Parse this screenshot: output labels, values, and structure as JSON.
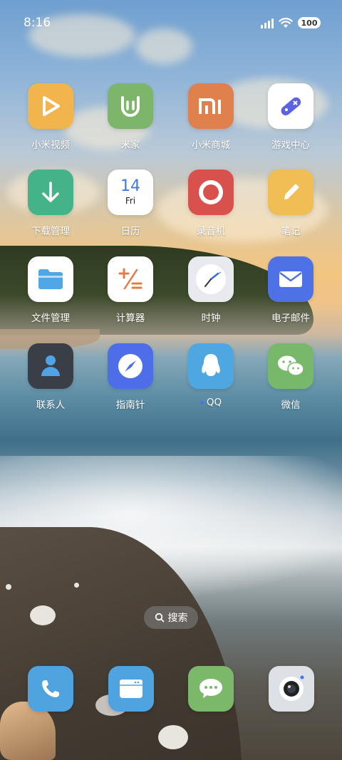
{
  "status_bar": {
    "time": "8:16",
    "battery": "100",
    "signal_icon": "cellular-signal-icon",
    "wifi_icon": "wifi-icon"
  },
  "apps": [
    {
      "label": "小米视频",
      "icon": "play-icon",
      "color": "#F2B54E"
    },
    {
      "label": "米家",
      "icon": "mijia-icon",
      "color": "#7DB56B"
    },
    {
      "label": "小米商城",
      "icon": "mi-logo-icon",
      "color": "#E0804C"
    },
    {
      "label": "游戏中心",
      "icon": "gamepad-icon",
      "color": "#FFFFFF"
    },
    {
      "label": "下载管理",
      "icon": "download-arrow-icon",
      "color": "#45B38A"
    },
    {
      "label": "日历",
      "icon": "calendar-icon",
      "color": "#FFFFFF",
      "day": "14",
      "weekday": "Fri"
    },
    {
      "label": "录音机",
      "icon": "record-icon",
      "color": "#D9514C"
    },
    {
      "label": "笔记",
      "icon": "pencil-icon",
      "color": "#F0BE55"
    },
    {
      "label": "文件管理",
      "icon": "folder-icon",
      "color": "#FFFFFF"
    },
    {
      "label": "计算器",
      "icon": "calculator-icon",
      "color": "#FFFFFF"
    },
    {
      "label": "时钟",
      "icon": "clock-icon",
      "color": "#E8EAF0"
    },
    {
      "label": "电子邮件",
      "icon": "envelope-icon",
      "color": "#4E72E6"
    },
    {
      "label": "联系人",
      "icon": "contact-icon",
      "color": "#3A3F47"
    },
    {
      "label": "指南针",
      "icon": "compass-icon",
      "color": "#4E6DE8"
    },
    {
      "label": "QQ",
      "icon": "qq-penguin-icon",
      "color": "#4EA7E0"
    },
    {
      "label": "微信",
      "icon": "wechat-icon",
      "color": "#78B86A"
    }
  ],
  "search": {
    "label": "搜索",
    "icon": "search-icon"
  },
  "dock": [
    {
      "name": "phone",
      "icon": "phone-icon",
      "color": "#4FA3DE"
    },
    {
      "name": "browser",
      "icon": "browser-icon",
      "color": "#4FA3DE"
    },
    {
      "name": "messages",
      "icon": "message-icon",
      "color": "#7CB86A"
    },
    {
      "name": "camera",
      "icon": "camera-icon",
      "color": "#DDE0E5"
    }
  ]
}
